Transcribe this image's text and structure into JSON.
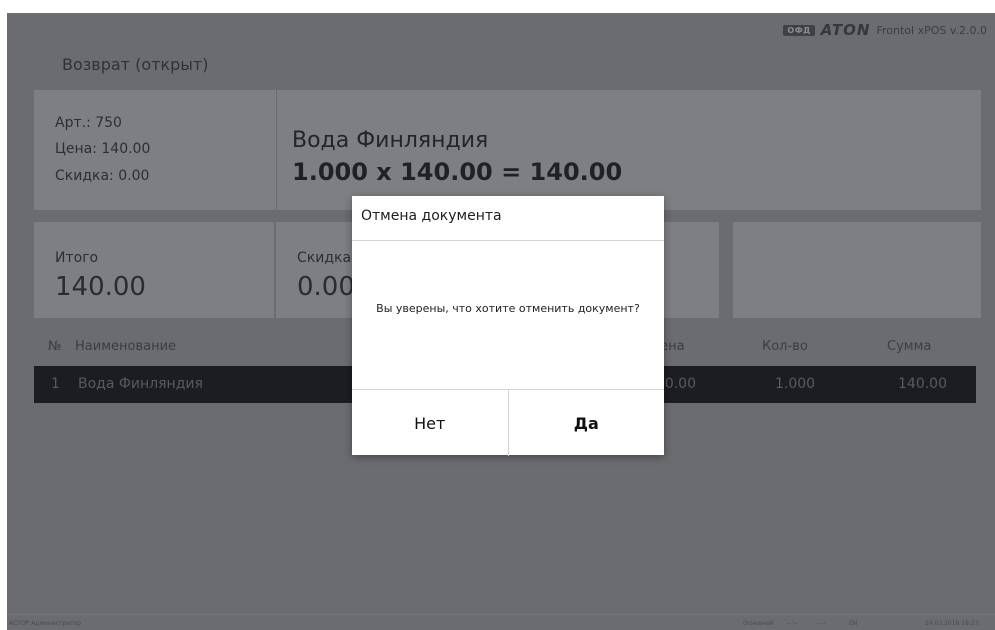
{
  "brand": {
    "ofd": "ОФД",
    "logo": "ATON",
    "app": "Frontol xPOS v.2.0.0"
  },
  "doc_status": "Возврат (открыт)",
  "item": {
    "art": "Арт.: 750",
    "price": "Цена:  140.00",
    "discount": "Скидка:  0.00",
    "name": "Вода Финляндия",
    "calc": "1.000 x 140.00 = 140.00"
  },
  "totals": {
    "total_label": "Итого",
    "total_value": "140.00",
    "discount_label": "Скидка",
    "discount_value": "0.00"
  },
  "table": {
    "headers": {
      "num": "№",
      "name": "Наименование",
      "price": "Цена",
      "qty": "Кол-во",
      "sum": "Сумма"
    },
    "rows": [
      {
        "num": "1",
        "name": "Вода Финляндия",
        "price": "140.00",
        "qty": "1.000",
        "sum": "140.00"
      }
    ]
  },
  "footer": {
    "user": "АСТОР  Администратор",
    "mode": "Основной",
    "t1": "--:--",
    "t2": "--:--",
    "lang": "EN",
    "datetime": "24.03.2018 18:37:"
  },
  "dialog": {
    "title": "Отмена документа",
    "message": "Вы уверены, что хотите отменить документ?",
    "no": "Нет",
    "yes": "Да"
  }
}
